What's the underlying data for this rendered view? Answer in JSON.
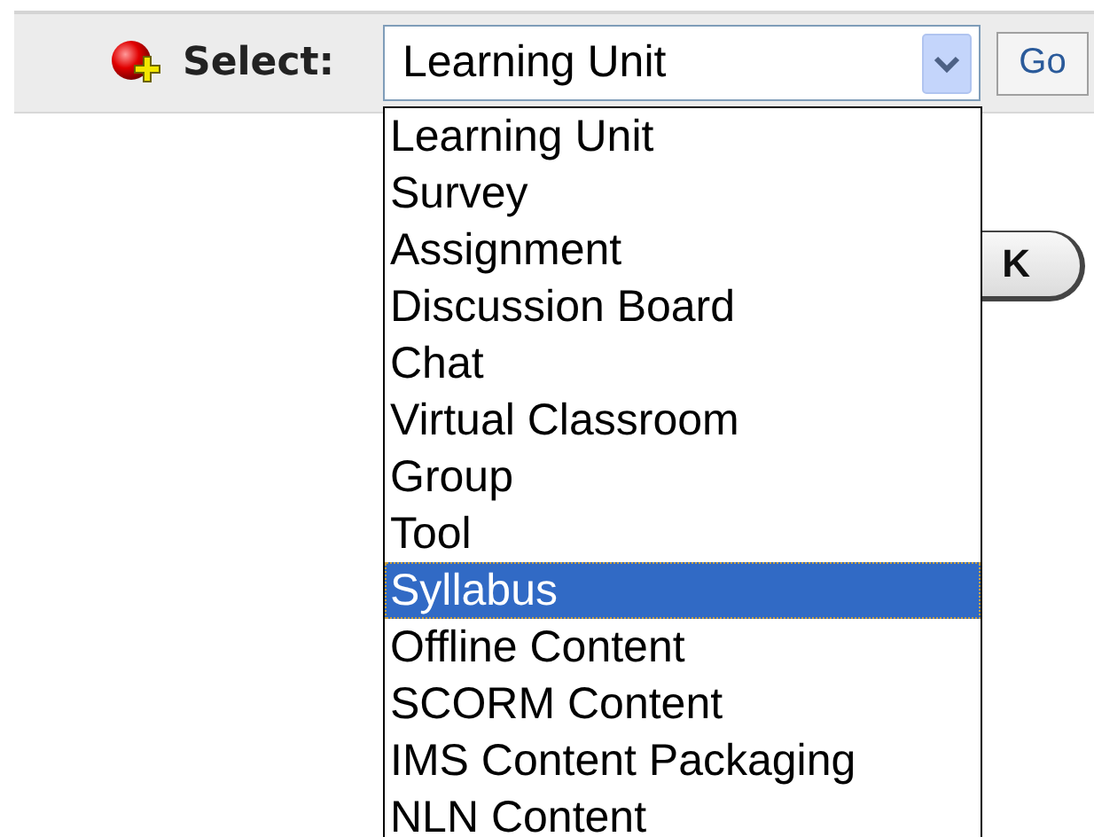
{
  "toolbar": {
    "label": "Select:",
    "dropdown": {
      "value": "Learning Unit"
    },
    "go_button": "Go"
  },
  "options": [
    {
      "label": "Learning Unit",
      "selected": false
    },
    {
      "label": "Survey",
      "selected": false
    },
    {
      "label": "Assignment",
      "selected": false
    },
    {
      "label": "Discussion Board",
      "selected": false
    },
    {
      "label": "Chat",
      "selected": false
    },
    {
      "label": "Virtual Classroom",
      "selected": false
    },
    {
      "label": "Group",
      "selected": false
    },
    {
      "label": "Tool",
      "selected": false
    },
    {
      "label": "Syllabus",
      "selected": true
    },
    {
      "label": "Offline Content",
      "selected": false
    },
    {
      "label": "SCORM Content",
      "selected": false
    },
    {
      "label": "IMS Content Packaging",
      "selected": false
    },
    {
      "label": "NLN Content",
      "selected": false
    }
  ],
  "ok_button": "K"
}
